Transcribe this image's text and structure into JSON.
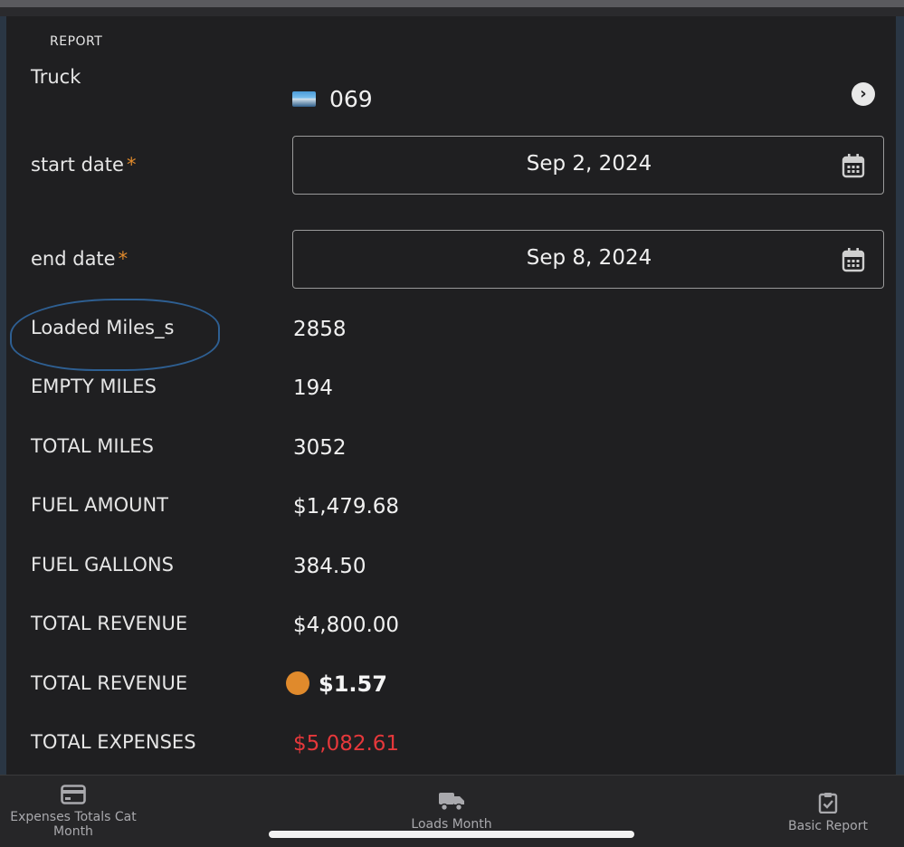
{
  "section_title": "REPORT",
  "truck": {
    "label": "Truck",
    "value": "069"
  },
  "start_date": {
    "label": "start date",
    "required_mark": "*",
    "value": "Sep 2, 2024"
  },
  "end_date": {
    "label": "end date",
    "required_mark": "*",
    "value": "Sep 8, 2024"
  },
  "rows": [
    {
      "label": "Loaded Miles_s",
      "value": "2858"
    },
    {
      "label": "EMPTY MILES",
      "value": "194"
    },
    {
      "label": "TOTAL MILES",
      "value": "3052"
    },
    {
      "label": "FUEL AMOUNT",
      "value": "$1,479.68"
    },
    {
      "label": "FUEL GALLONS",
      "value": "384.50"
    },
    {
      "label": "TOTAL REVENUE",
      "value": "$4,800.00"
    },
    {
      "label": "TOTAL REVENUE",
      "value": "$1.57"
    },
    {
      "label": "TOTAL EXPENSES",
      "value": "$5,082.61"
    }
  ],
  "tabs": [
    {
      "label": "Expenses Totals Cat Month",
      "icon": "credit-card-icon"
    },
    {
      "label": "Loads Month",
      "icon": "truck-icon"
    },
    {
      "label": "Basic Report",
      "icon": "clipboard-check-icon"
    }
  ],
  "colors": {
    "accent_orange": "#e08a2c",
    "expense_red": "#e5383b",
    "background": "#1f1f21"
  }
}
